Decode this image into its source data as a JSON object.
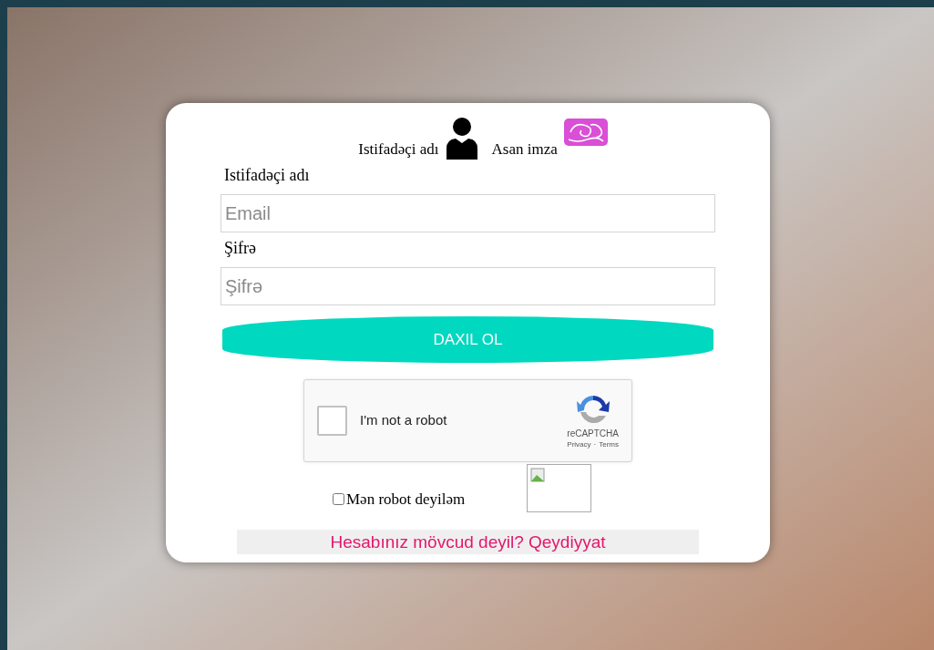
{
  "login_methods": [
    {
      "label": "Istifadəçi adı",
      "kind": "user"
    },
    {
      "label": "Asan imza",
      "kind": "asan"
    }
  ],
  "fields": [
    {
      "label": "Istifadəçi adı",
      "placeholder": "Email"
    },
    {
      "label": "Şifrə",
      "placeholder": "Şifrə"
    }
  ],
  "submit": "DAXIL OL",
  "recaptcha": {
    "label": "I'm not a robot",
    "checked": false,
    "brand": "reCAPTCHA",
    "privacy": "Privacy",
    "separator": "·",
    "terms": "Terms"
  },
  "robot_checkbox": {
    "label": "Mən robot deyiləm",
    "checked": false
  },
  "register_link": "Hesabınız mövcud deyil? Qeydiyyat"
}
